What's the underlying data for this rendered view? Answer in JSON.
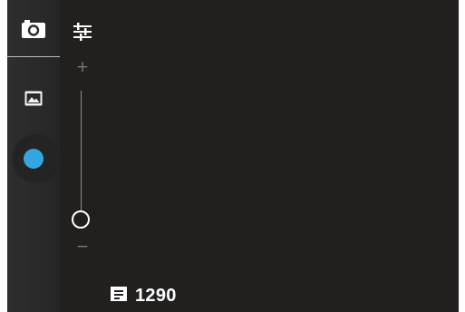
{
  "side_panel": {
    "camera_icon": "camera-icon",
    "gallery_icon": "image-icon",
    "shutter_icon": "shutter-dot-icon",
    "accent_color": "#34a6df"
  },
  "settings": {
    "icon": "settings-sliders-icon"
  },
  "zoom": {
    "plus_label": "+",
    "minus_label": "−",
    "level": 0
  },
  "storage": {
    "icon": "sd-card-icon",
    "remaining_shots": "1290"
  }
}
